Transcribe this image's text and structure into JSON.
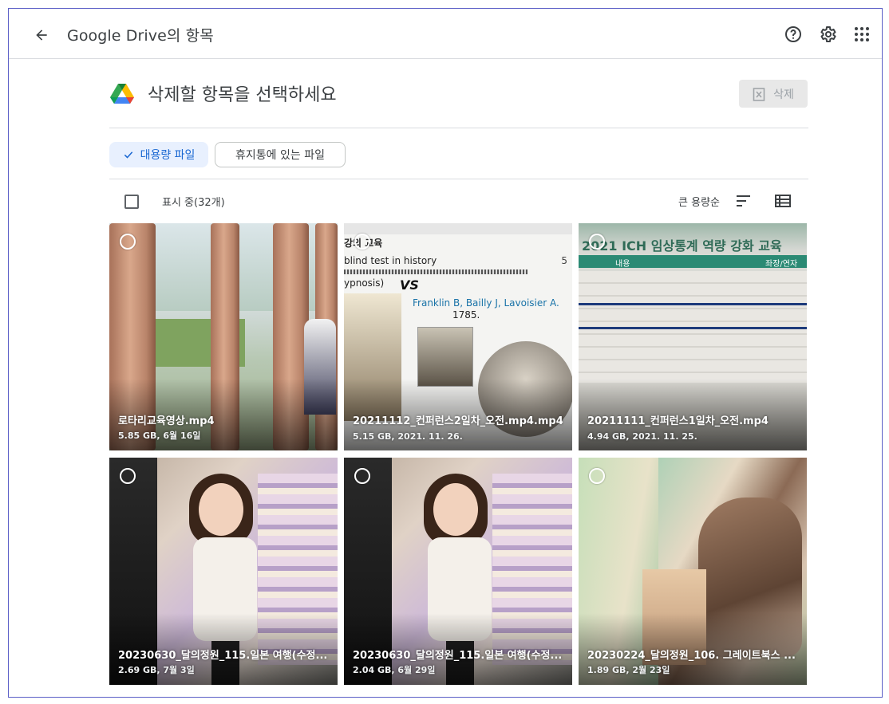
{
  "header": {
    "title": "Google Drive의 항목",
    "back_icon": "arrow-back-icon",
    "help_icon": "help-circle-icon",
    "settings_icon": "gear-icon",
    "apps_icon": "apps-grid-icon"
  },
  "main": {
    "title": "삭제할 항목을 선택하세요",
    "delete_label": "삭제",
    "filters": {
      "large_files": "대용량 파일",
      "trash_files": "휴지통에 있는 파일"
    },
    "showing_label": "표시 중(32개)",
    "sort_label": "큰 용량순"
  },
  "files": [
    {
      "name": "로타리교육영상.mp4",
      "meta": "5.85 GB, 6월 16일",
      "thumb": "campus"
    },
    {
      "name": "20211112_컨퍼런스2일차_오전.mp4.mp4",
      "meta": "5.15 GB, 2021. 11. 26.",
      "thumb": "slides"
    },
    {
      "name": "20211111_컨퍼런스1일차_오전.mp4",
      "meta": "4.94 GB, 2021. 11. 25.",
      "thumb": "ich"
    },
    {
      "name": "20230630_달의정원_115.일본 여행(수정...",
      "meta": "2.69 GB, 7월 3일",
      "thumb": "kid"
    },
    {
      "name": "20230630_달의정원_115.일본 여행(수정...",
      "meta": "2.04 GB, 6월 29일",
      "thumb": "kid"
    },
    {
      "name": "20230224_달의정원_106. 그레이트북스 ...",
      "meta": "1.89 GB, 2월 23일",
      "thumb": "blur"
    }
  ],
  "slide_text": {
    "line1": "강의 교육",
    "line2": "blind test in history",
    "line3": "ypnosis)",
    "line4": "Franklin B, Bailly J, Lavoisier A.",
    "line5": "1785.",
    "page": "5"
  },
  "ich_text": {
    "title": "2021 ICH 임상통계 역량 강화 교육",
    "col1": "내용",
    "col2": "좌장/연자"
  },
  "colors": {
    "accent": "#1967d2",
    "chip_bg": "#e8f0fe",
    "frame_border": "#5b5fc7"
  }
}
